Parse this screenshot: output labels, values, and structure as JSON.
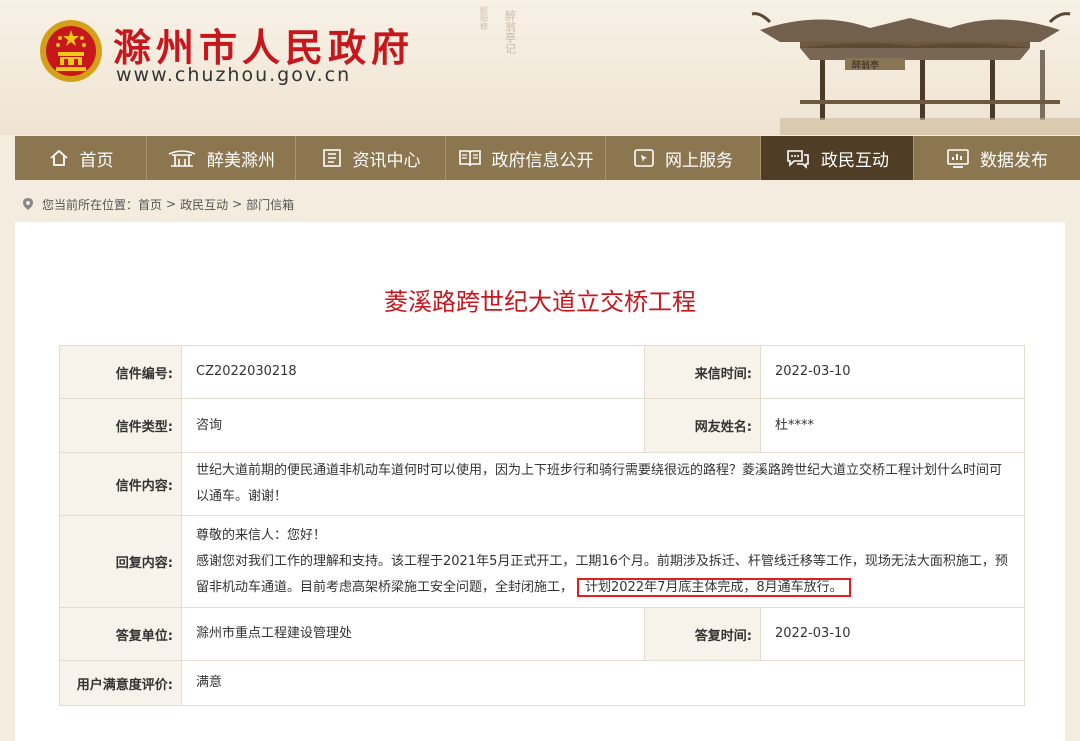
{
  "header": {
    "title": "滁州市人民政府",
    "url": "www.chuzhou.gov.cn",
    "calligraphy_text": "醉翁亭记",
    "calligraphy_author": "欧阳修",
    "pavilion_plaque": "醉翁亭"
  },
  "nav": {
    "items": [
      {
        "label": "首页",
        "icon": "home-icon"
      },
      {
        "label": "醉美滁州",
        "icon": "pavilion-icon"
      },
      {
        "label": "资讯中心",
        "icon": "document-icon"
      },
      {
        "label": "政府信息公开",
        "icon": "book-icon"
      },
      {
        "label": "网上服务",
        "icon": "cursor-window-icon"
      },
      {
        "label": "政民互动",
        "icon": "chat-icon"
      },
      {
        "label": "数据发布",
        "icon": "chart-icon"
      }
    ],
    "active_index": 5
  },
  "breadcrumb": {
    "prefix": "您当前所在位置：",
    "items": [
      "首页",
      "政民互动",
      "部门信箱"
    ],
    "separator": ">"
  },
  "letter": {
    "title": "菱溪路跨世纪大道立交桥工程",
    "number_label": "信件编号:",
    "number": "CZ2022030218",
    "date_label": "来信时间:",
    "date": "2022-03-10",
    "type_label": "信件类型:",
    "type": "咨询",
    "author_label": "网友姓名:",
    "author": "杜****",
    "content_label": "信件内容:",
    "content": "世纪大道前期的便民通道非机动车道何时可以使用，因为上下班步行和骑行需要绕很远的路程？菱溪路跨世纪大道立交桥工程计划什么时间可以通车。谢谢！",
    "reply_label": "回复内容:",
    "reply_greeting": "尊敬的来信人：您好！",
    "reply_body": "感谢您对我们工作的理解和支持。该工程于2021年5月正式开工，工期16个月。前期涉及拆迁、杆管线迁移等工作，现场无法大面积施工，预留非机动车通道。目前考虑高架桥梁施工安全问题，全封闭施工，",
    "reply_highlight": "计划2022年7月底主体完成，8月通车放行。",
    "unit_label": "答复单位:",
    "unit": "滁州市重点工程建设管理处",
    "reply_date_label": "答复时间:",
    "reply_date": "2022-03-10",
    "rating_label": "用户满意度评价:",
    "rating": "满意"
  },
  "colors": {
    "brand_red": "#c8161d",
    "nav_bg": "#8b7650",
    "nav_active": "#4f3d25",
    "highlight_box": "#e02020"
  }
}
